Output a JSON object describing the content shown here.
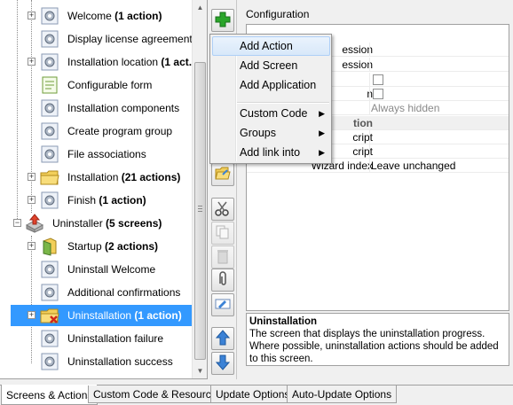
{
  "tree": {
    "items": [
      {
        "label": "Welcome ",
        "bold": "(1 action)",
        "icon": "gear-icon",
        "selected": false
      },
      {
        "label": "Display license agreement",
        "bold": "",
        "icon": "gear-icon",
        "selected": false
      },
      {
        "label": "Installation location ",
        "bold": "(1 act...",
        "icon": "gear-icon",
        "selected": false
      },
      {
        "label": "Configurable form",
        "bold": "",
        "icon": "form-icon",
        "selected": false
      },
      {
        "label": "Installation components",
        "bold": "",
        "icon": "gear-icon",
        "selected": false
      },
      {
        "label": "Create program group",
        "bold": "",
        "icon": "gear-icon",
        "selected": false
      },
      {
        "label": "File associations",
        "bold": "",
        "icon": "gear-icon",
        "selected": false
      },
      {
        "label": "Installation ",
        "bold": "(21 actions)",
        "icon": "folder-icon",
        "selected": false
      },
      {
        "label": "Finish ",
        "bold": "(1 action)",
        "icon": "gear-icon",
        "selected": false
      },
      {
        "label": "Uninstaller ",
        "bold": "(5 screens)",
        "icon": "uninstaller-icon",
        "selected": false
      },
      {
        "label": "Startup ",
        "bold": "(2 actions)",
        "icon": "startup-icon",
        "selected": false
      },
      {
        "label": "Uninstall Welcome",
        "bold": "",
        "icon": "gear-icon",
        "selected": false
      },
      {
        "label": "Additional confirmations",
        "bold": "",
        "icon": "gear-icon",
        "selected": false
      },
      {
        "label": "Uninstallation ",
        "bold": "(1 action)",
        "icon": "folder-delete-icon",
        "selected": true
      },
      {
        "label": "Uninstallation failure",
        "bold": "",
        "icon": "gear-icon",
        "selected": false
      },
      {
        "label": "Uninstallation success",
        "bold": "",
        "icon": "gear-icon",
        "selected": false
      }
    ]
  },
  "config": {
    "title": "Configuration",
    "rows": [
      {
        "name": "ession",
        "value": ""
      },
      {
        "name": "ession",
        "value": ""
      },
      {
        "name": "",
        "value": "",
        "checkbox": true
      },
      {
        "name": "n",
        "value": "",
        "checkbox": true
      },
      {
        "name": "",
        "value": "Always hidden"
      },
      {
        "name": "tion",
        "value": "",
        "category": true
      },
      {
        "name": "cript",
        "value": ""
      },
      {
        "name": "cript",
        "value": ""
      },
      {
        "name": "Wizard index",
        "value": "Leave unchanged"
      }
    ]
  },
  "description": {
    "title": "Uninstallation",
    "text": "The screen that displays the uninstallation progress. Where possible, uninstallation actions should be added to this screen."
  },
  "popup": {
    "items": [
      {
        "label": "Add Action",
        "submenu": false
      },
      {
        "label": "Add Screen",
        "submenu": false
      },
      {
        "label": "Add Application",
        "submenu": false
      },
      {
        "label": "Custom Code",
        "submenu": true
      },
      {
        "label": "Groups",
        "submenu": true
      },
      {
        "label": "Add link into",
        "submenu": true
      }
    ]
  },
  "tabs": [
    {
      "label": "Screens & Actions",
      "active": true
    },
    {
      "label": "Custom Code & Resources",
      "active": false
    },
    {
      "label": "Update Options",
      "active": false
    },
    {
      "label": "Auto-Update Options",
      "active": false
    }
  ],
  "colors": {
    "selection": "#3399ff",
    "add_green": "#2aa52a",
    "arrow_blue": "#3b82d6"
  }
}
